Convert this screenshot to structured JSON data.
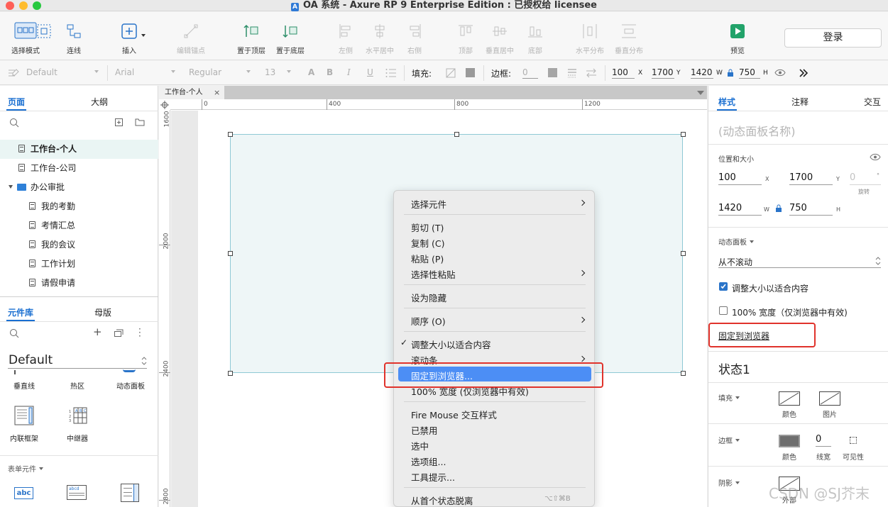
{
  "window": {
    "title": "OA 系统 - Axure RP 9 Enterprise Edition : 已授权给 licensee"
  },
  "toolbar": {
    "select_mode": "选择模式",
    "connect": "连线",
    "insert": "插入",
    "edit_anchor": "编辑锚点",
    "bring_front": "置于顶层",
    "send_back": "置于底层",
    "align_left": "左侧",
    "align_hcenter": "水平居中",
    "align_right": "右侧",
    "align_top": "顶部",
    "align_vcenter": "垂直居中",
    "align_bottom": "底部",
    "dist_h": "水平分布",
    "dist_v": "垂直分布",
    "preview": "预览",
    "login": "登录"
  },
  "format": {
    "style": "Default",
    "font": "Arial",
    "weight": "Regular",
    "size": "13",
    "fill_label": "填充:",
    "border_label": "边框:",
    "border_width": "0",
    "x": "100",
    "y": "1700",
    "w": "1420",
    "h": "750",
    "x_label": "X",
    "y_label": "Y",
    "w_label": "W",
    "h_label": "H"
  },
  "left": {
    "tab_pages": "页面",
    "tab_outline": "大纲",
    "pages": [
      {
        "label": "工作台-个人"
      },
      {
        "label": "工作台-公司"
      },
      {
        "label": "办公审批"
      },
      {
        "label": "我的考勤"
      },
      {
        "label": "考情汇总"
      },
      {
        "label": "我的会议"
      },
      {
        "label": "工作计划"
      },
      {
        "label": "请假申请"
      }
    ],
    "tab_library": "元件库",
    "tab_masters": "母版",
    "library_name": "Default",
    "widgets": [
      "垂直线",
      "热区",
      "动态面板",
      "内联框架",
      "中继器"
    ],
    "form_section": "表单元件",
    "widget_text_1": "abc",
    "widget_text_2": "abcd",
    "widget_grid": [
      "A",
      "B",
      "C",
      "1",
      "2",
      "3"
    ]
  },
  "canvas": {
    "tab": "工作台-个人",
    "ruler_h": [
      "0",
      "400",
      "800",
      "1200"
    ],
    "ruler_v": [
      "1600",
      "2000",
      "2400",
      "2800"
    ]
  },
  "menu": {
    "items": [
      "选择元件",
      "剪切 (T)",
      "复制 (C)",
      "粘贴 (P)",
      "选择性粘贴",
      "设为隐藏",
      "顺序 (O)",
      "调整大小以适合内容",
      "滚动条",
      "固定到浏览器...",
      "100% 宽度 (仅浏览器中有效)",
      "Fire Mouse 交互样式",
      "已禁用",
      "选中",
      "选项组...",
      "工具提示...",
      "从首个状态脱离"
    ],
    "checkmark": "✓",
    "shortcut": "⌥⇧⌘B"
  },
  "right": {
    "tab_style": "样式",
    "tab_notes": "注释",
    "tab_interact": "交互",
    "name_placeholder": "(动态面板名称)",
    "pos_size_label": "位置和大小",
    "x": "100",
    "y": "1700",
    "rotation": "0",
    "w": "1420",
    "h": "750",
    "x_label": "X",
    "y_label": "Y",
    "rot_label": "旋转",
    "deg_label": "°",
    "w_label": "W",
    "h_label": "H",
    "dynamic_panel_label": "动态面板",
    "scroll_value": "从不滚动",
    "fit_content": "调整大小以适合内容",
    "full_width": "100% 宽度（仅浏览器中有效)",
    "pin_browser": "固定到浏览器",
    "state_name": "状态1",
    "fill_label": "填充",
    "fill_color": "颜色",
    "fill_image": "图片",
    "border_label": "边框",
    "border_color": "颜色",
    "border_width_label": "线宽",
    "border_width": "0",
    "border_visible": "可见性",
    "shadow_label": "阴影",
    "shadow_outer": "外部"
  },
  "watermark": "CSDN @SJ芥末",
  "colors": {
    "accent": "#1a6fd1",
    "highlight": "#4c8ef5",
    "red_outline": "#e0332c",
    "panel_fill": "#eef6f7"
  }
}
